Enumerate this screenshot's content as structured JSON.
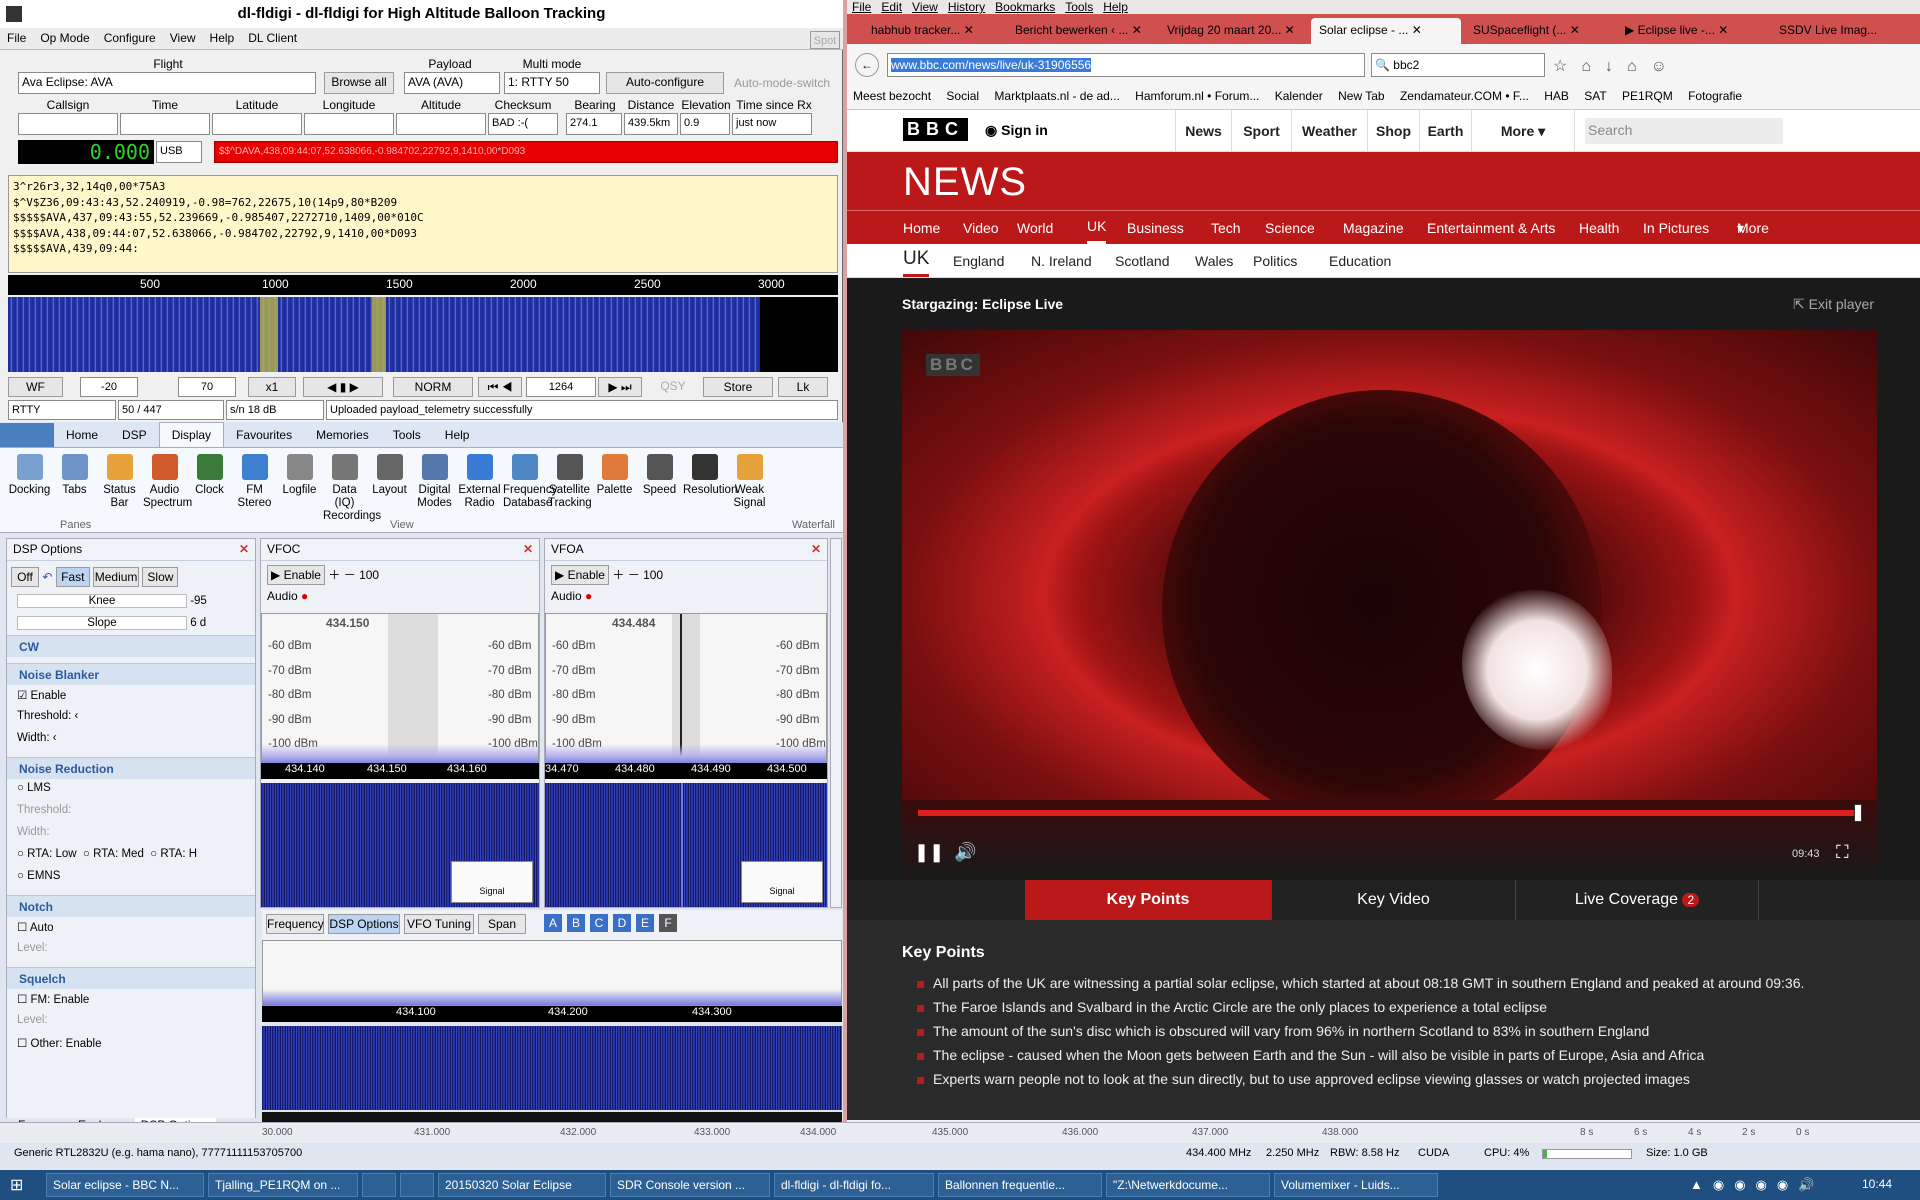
{
  "fldigi": {
    "title": "dl-fldigi - dl-fldigi for High Altitude Balloon Tracking",
    "menu": [
      "File",
      "Op Mode",
      "Configure",
      "View",
      "Help",
      "DL Client"
    ],
    "spot": "Spot",
    "flight_label": "Flight",
    "flight_value": "Ava Eclipse: AVA",
    "browse_all": "Browse all",
    "payload_label": "Payload",
    "payload_value": "AVA (AVA)",
    "multimode_label": "Multi mode",
    "multimode_value": "1: RTTY 50",
    "autoconfig": "Auto-configure",
    "automode": "Auto-mode-switch",
    "fields": {
      "callsign": "Callsign",
      "time": "Time",
      "latitude": "Latitude",
      "longitude": "Longitude",
      "altitude": "Altitude",
      "checksum": "Checksum",
      "bearing": "Bearing",
      "distance": "Distance",
      "elevation": "Elevation",
      "since": "Time since Rx"
    },
    "values": {
      "checksum": "BAD :-(",
      "bearing": "274.1",
      "distance": "439.5km",
      "elevation": "0.9",
      "since": "just now"
    },
    "freq": "0.000",
    "mode": "USB",
    "sentence": "$$^DAVA,438,09:44:07,52.638066,-0.984702,22792,9,1410,00*D093",
    "rx_text": "3^r26r3,32,14q0,00*75A3\n$^V$Z36,09:43:43,52.240919,-0.98=762,22675,10(14p9,80*B209\n$$$$$AVA,437,09:43:55,52.239669,-0.985407,2272710,1409,00*010C\n$$$$AVA,438,09:44:07,52.638066,-0.984702,22792,9,1410,00*D093\n$$$$$AVA,439,09:44:",
    "scale": [
      "500",
      "1000",
      "1500",
      "2000",
      "2500",
      "3000"
    ],
    "ctrl": {
      "wf": "WF",
      "ref": "-20",
      "range": "70",
      "zoom": "x1",
      "norm": "NORM",
      "carrier": "1264",
      "qsy": "QSY",
      "store": "Store",
      "lk": "Lk"
    },
    "status": {
      "mode": "RTTY",
      "count": "50 / 447",
      "sn": "s/n  18 dB",
      "msg": "Uploaded payload_telemetry successfully"
    }
  },
  "sdr": {
    "tabs": [
      "Home",
      "DSP",
      "Display",
      "Favourites",
      "Memories",
      "Tools",
      "Help"
    ],
    "ribbon": [
      {
        "label": "Docking",
        "icon": "docking-icon"
      },
      {
        "label": "Tabs",
        "icon": "tabs-icon"
      },
      {
        "label": "Status Bar",
        "icon": "status-bar-icon"
      },
      {
        "label": "Audio Spectrum",
        "icon": "audio-spectrum-icon"
      },
      {
        "label": "Clock",
        "icon": "clock-icon"
      },
      {
        "label": "FM Stereo",
        "icon": "fm-stereo-icon"
      },
      {
        "label": "Logfile",
        "icon": "logfile-icon"
      },
      {
        "label": "Data (IQ) Recordings",
        "icon": "data-recordings-icon"
      },
      {
        "label": "Layout",
        "icon": "layout-icon"
      },
      {
        "label": "Digital Modes",
        "icon": "digital-modes-icon"
      },
      {
        "label": "External Radio",
        "icon": "external-radio-icon"
      },
      {
        "label": "Frequency Database",
        "icon": "frequency-database-icon"
      },
      {
        "label": "Satellite Tracking",
        "icon": "satellite-icon"
      },
      {
        "label": "Palette",
        "icon": "palette-icon"
      },
      {
        "label": "Speed",
        "icon": "speed-icon"
      },
      {
        "label": "Resolution",
        "icon": "resolution-icon"
      },
      {
        "label": "Weak Signal",
        "icon": "weak-signal-icon"
      }
    ],
    "groups": {
      "panes": "Panes",
      "view": "View",
      "waterfall": "Waterfall"
    },
    "dsp": {
      "title": "DSP Options",
      "agc": [
        "Off",
        "Fast",
        "Medium",
        "Slow"
      ],
      "knee": "Knee",
      "knee_val": "-95",
      "slope": "Slope",
      "slope_val": "6 d",
      "cw": "CW",
      "nb": "Noise Blanker",
      "nb_enable": "Enable",
      "threshold": "Threshold:",
      "width": "Width:",
      "nr": "Noise Reduction",
      "lms": "LMS",
      "rta_low": "RTA: Low",
      "rta_med": "RTA: Med",
      "rta_high": "RTA: H",
      "emns": "EMNS",
      "notch": "Notch",
      "auto": "Auto",
      "level": "Level:",
      "squelch": "Squelch",
      "fm_enable": "FM: Enable",
      "other_enable": "Other: Enable"
    },
    "vfoc": {
      "title": "VFOC",
      "enable": "Enable",
      "audio": "Audio",
      "hundred": "100",
      "freq": "434.150",
      "dbm": [
        "-60 dBm",
        "-70 dBm",
        "-80 dBm",
        "-90 dBm",
        "-100 dBm"
      ],
      "axis": [
        "434.140",
        "434.150",
        "434.160"
      ]
    },
    "vfoa": {
      "title": "VFOA",
      "enable": "Enable",
      "audio": "Audio",
      "hundred": "100",
      "freq": "434.484",
      "dbm": [
        "-60 dBm",
        "-70 dBm",
        "-80 dBm",
        "-90 dBm",
        "-100 dBm"
      ],
      "axis": [
        "34.470",
        "434.480",
        "434.490",
        "434.500"
      ]
    },
    "signal": "Signal",
    "main_tabs": [
      "Frequency",
      "DSP Options",
      "VFO Tuning",
      "Span"
    ],
    "letters": [
      "A",
      "B",
      "C",
      "D",
      "E",
      "F"
    ],
    "main_axis": [
      "434.100",
      "434.200",
      "434.300"
    ],
    "bottom_axis": [
      "30.000",
      "431.000",
      "432.000",
      "433.000",
      "434.000",
      "435.000",
      "436.000",
      "437.000",
      "438.000"
    ],
    "bottom_tabs": [
      "Frequency Explorer",
      "DSP Options"
    ],
    "time_axis": [
      "8 s",
      "6 s",
      "4 s",
      "2 s",
      "0 s"
    ],
    "status": {
      "device": "Generic RTL2832U (e.g. hama nano), 77771111153705700",
      "freq": "434.400 MHz",
      "bw": "2.250 MHz",
      "rbw": "RBW: 8.58 Hz",
      "cuda": "CUDA",
      "cpu": "CPU: 4%",
      "cpu_fraction": 0.04,
      "size": "Size: 1.0 GB"
    }
  },
  "browser": {
    "menu": [
      "File",
      "Edit",
      "View",
      "History",
      "Bookmarks",
      "Tools",
      "Help"
    ],
    "tabs": [
      "habhub tracker...",
      "Bericht bewerken ‹ ...",
      "Vrijdag 20 maart 20...",
      "Solar eclipse - ...",
      "SUSpaceflight (...",
      "▶ Eclipse live -...",
      "SSDV Live Imag..."
    ],
    "url": "www.bbc.com/news/live/uk-31906556",
    "search": "bbc2",
    "bookmarks": [
      "Meest bezocht",
      "Social",
      "Marktplaats.nl - de ad...",
      "Hamforum.nl • Forum...",
      "Kalender",
      "New Tab",
      "Zendamateur.COM • F...",
      "HAB",
      "SAT",
      "PE1RQM",
      "Fotografie"
    ],
    "bbc": {
      "logo": "BBC",
      "signin": "Sign in",
      "top": [
        "News",
        "Sport",
        "Weather",
        "Shop",
        "Earth",
        "More"
      ],
      "search_ph": "Search",
      "news": "NEWS",
      "nav": [
        "Home",
        "Video",
        "World",
        "UK",
        "Business",
        "Tech",
        "Science",
        "Magazine",
        "Entertainment & Arts",
        "Health",
        "In Pictures",
        "More"
      ],
      "subnav": [
        "UK",
        "England",
        "N. Ireland",
        "Scotland",
        "Wales",
        "Politics",
        "Education"
      ],
      "player_title": "Stargazing: Eclipse Live",
      "exit": "Exit player",
      "watermark": "BBC",
      "time": "09:43",
      "kp_tabs": [
        "Key Points",
        "Key Video",
        "Live Coverage"
      ],
      "live_badge": "2",
      "kp_title": "Key Points",
      "points": [
        "All parts of the UK are witnessing a partial solar eclipse, which started at about 08:18 GMT in southern England and peaked at around 09:36.",
        "The Faroe Islands and Svalbard in the Arctic Circle are the only places to experience a total eclipse",
        "The amount of the sun's disc which is obscured will vary from 96% in northern Scotland to 83% in southern England",
        "The eclipse - caused when the Moon gets between Earth and the Sun - will also be visible in parts of Europe, Asia and Africa",
        "Experts warn people not to look at the sun directly, but to use approved eclipse viewing glasses or watch projected images"
      ]
    }
  },
  "taskbar": {
    "items": [
      "Solar eclipse - BBC N...",
      "Tjalling_PE1RQM on ...",
      "",
      "",
      "20150320 Solar Eclipse",
      "SDR Console version ...",
      "dl-fldigi - dl-fldigi fo...",
      "Ballonnen frequentie...",
      "\"Z:\\Netwerkdocume...",
      "Volumemixer - Luids..."
    ],
    "clock": "10:44"
  }
}
